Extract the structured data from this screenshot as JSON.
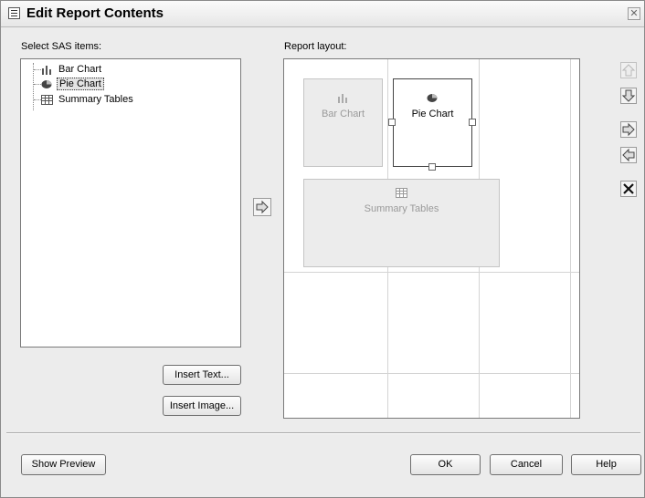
{
  "window": {
    "title": "Edit Report Contents"
  },
  "left": {
    "label": "Select SAS items:",
    "items": [
      {
        "label": "Bar Chart",
        "icon": "bar-chart-icon"
      },
      {
        "label": "Pie Chart",
        "icon": "pie-chart-icon",
        "selected": true
      },
      {
        "label": "Summary Tables",
        "icon": "table-icon"
      }
    ]
  },
  "right": {
    "label": "Report layout:",
    "blocks": [
      {
        "label": "Bar Chart",
        "icon": "bar-chart-icon"
      },
      {
        "label": "Pie Chart",
        "icon": "pie-chart-icon",
        "selected": true
      },
      {
        "label": "Summary Tables",
        "icon": "table-icon"
      }
    ]
  },
  "buttons": {
    "insert_text": "Insert Text...",
    "insert_image": "Insert Image...",
    "show_preview": "Show Preview",
    "ok": "OK",
    "cancel": "Cancel",
    "help": "Help"
  },
  "side_buttons": [
    "move-up-icon",
    "move-down-icon",
    "move-right-icon",
    "move-left-icon",
    "delete-icon"
  ]
}
